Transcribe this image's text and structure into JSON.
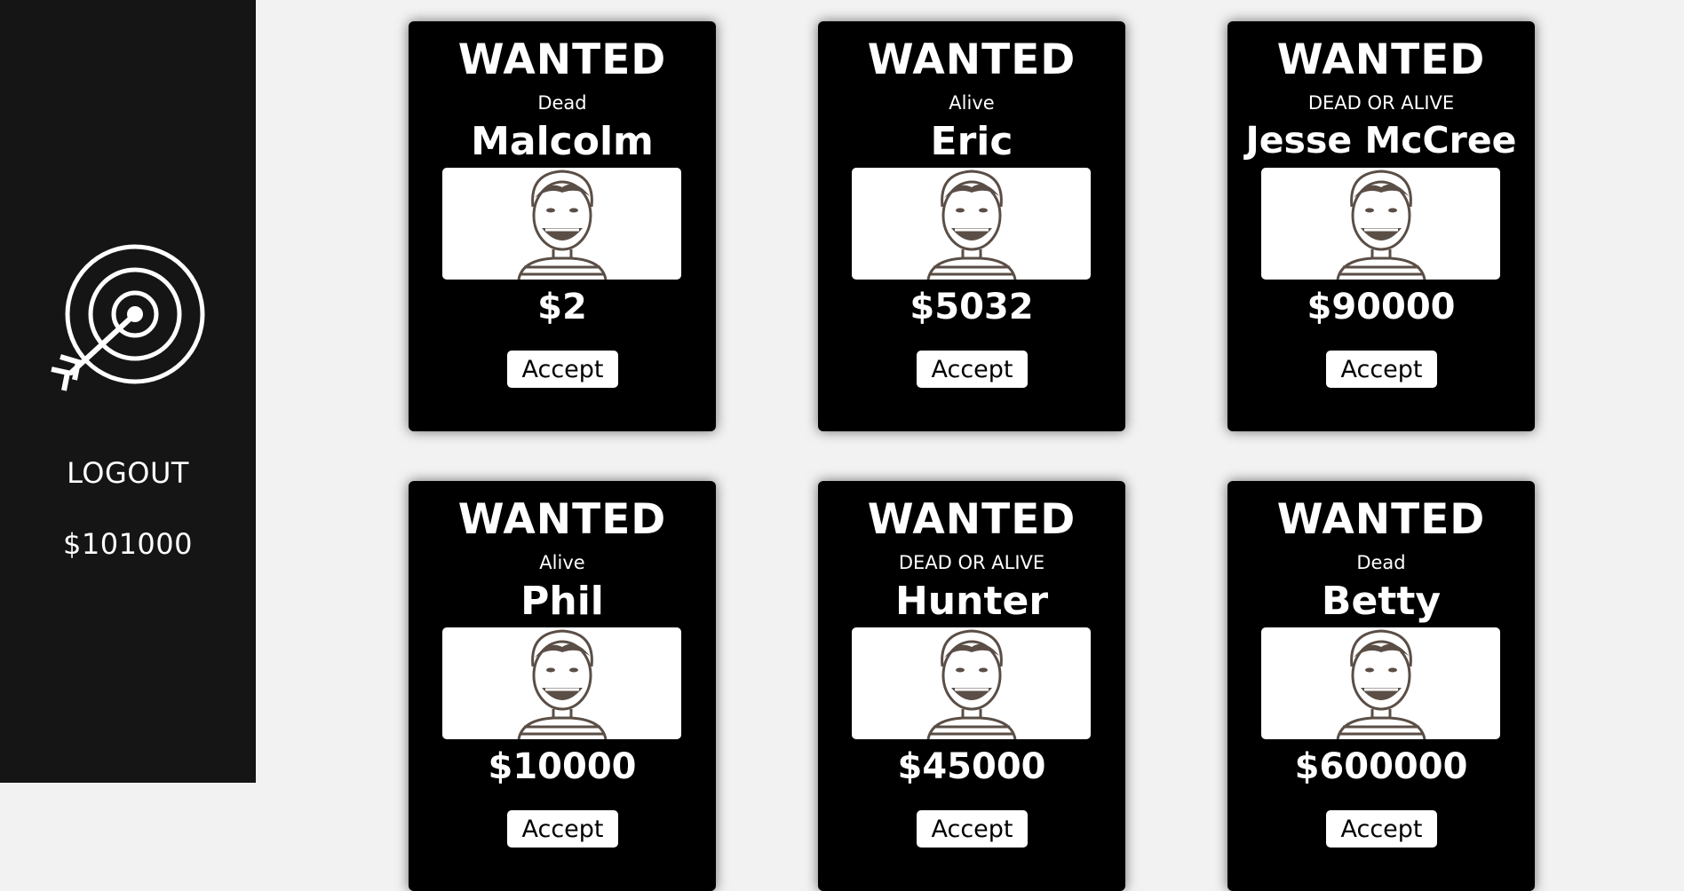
{
  "sidebar": {
    "logo_icon": "target-arrow-icon",
    "logout_label": "LOGOUT",
    "balance": "$101000"
  },
  "colors": {
    "sidebar_bg": "#151515",
    "page_bg": "#f2f2f2",
    "card_bg": "#000000",
    "text": "#ffffff"
  },
  "cards": [
    {
      "heading": "WANTED",
      "status": "Dead",
      "name": "Malcolm",
      "reward": "$2",
      "button": "Accept"
    },
    {
      "heading": "WANTED",
      "status": "Alive",
      "name": "Eric",
      "reward": "$5032",
      "button": "Accept"
    },
    {
      "heading": "WANTED",
      "status": "DEAD OR ALIVE",
      "name": "Jesse McCree",
      "reward": "$90000",
      "button": "Accept"
    },
    {
      "heading": "WANTED",
      "status": "Alive",
      "name": "Phil",
      "reward": "$10000",
      "button": "Accept"
    },
    {
      "heading": "WANTED",
      "status": "DEAD OR ALIVE",
      "name": "Hunter",
      "reward": "$45000",
      "button": "Accept"
    },
    {
      "heading": "WANTED",
      "status": "Dead",
      "name": "Betty",
      "reward": "$600000",
      "button": "Accept"
    }
  ]
}
